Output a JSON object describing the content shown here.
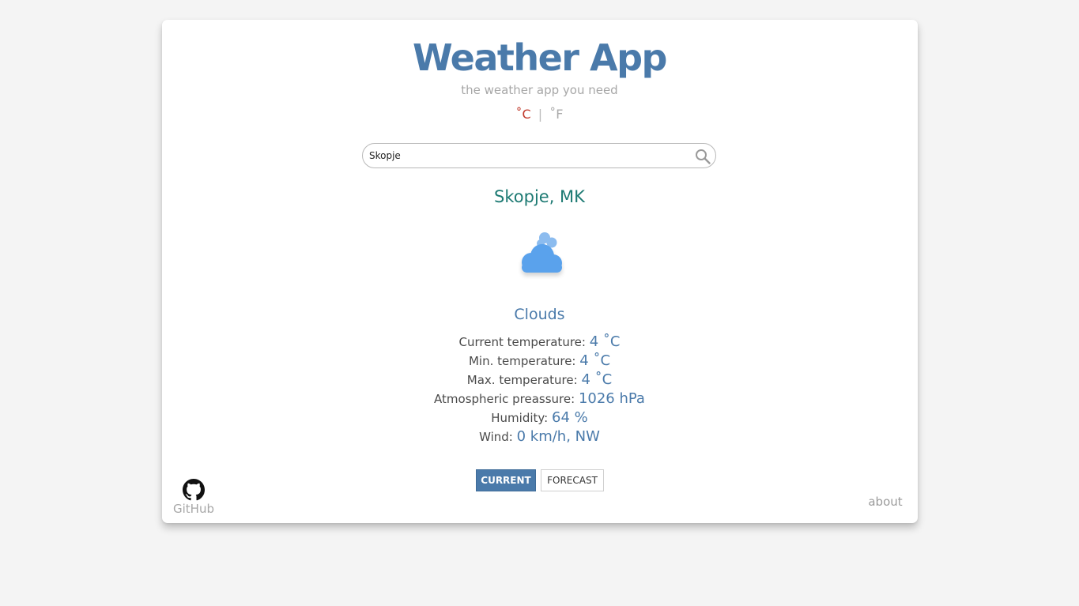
{
  "header": {
    "title": "Weather App",
    "subtitle": "the weather app you need"
  },
  "units": {
    "celsius": "˚C",
    "separator": "|",
    "fahrenheit": "˚F",
    "active": "celsius"
  },
  "search": {
    "value": "Skopje",
    "placeholder": "",
    "icon": "search-icon"
  },
  "location": {
    "city": "Skopje, MK"
  },
  "weather": {
    "icon": "cloud-icon",
    "condition": "Clouds",
    "stats": [
      {
        "label": "Current temperature:",
        "value": "4 ˚C"
      },
      {
        "label": "Min. temperature:",
        "value": "4 ˚C"
      },
      {
        "label": "Max. temperature:",
        "value": "4 ˚C"
      },
      {
        "label": "Atmospheric preassure:",
        "value": "1026 hPa"
      },
      {
        "label": "Humidity:",
        "value": "64 %"
      },
      {
        "label": "Wind:",
        "value": "0 km/h, NW"
      }
    ]
  },
  "tabs": {
    "current_label": "CURRENT",
    "forecast_label": "FORECAST",
    "active": "current"
  },
  "footer": {
    "github_label": "GitHub",
    "github_icon": "github-icon",
    "about_label": "about"
  },
  "colors": {
    "accent": "#4a7aaa",
    "city": "#1d7a73",
    "active_unit": "#c0392b",
    "background": "#f4f4f4"
  }
}
